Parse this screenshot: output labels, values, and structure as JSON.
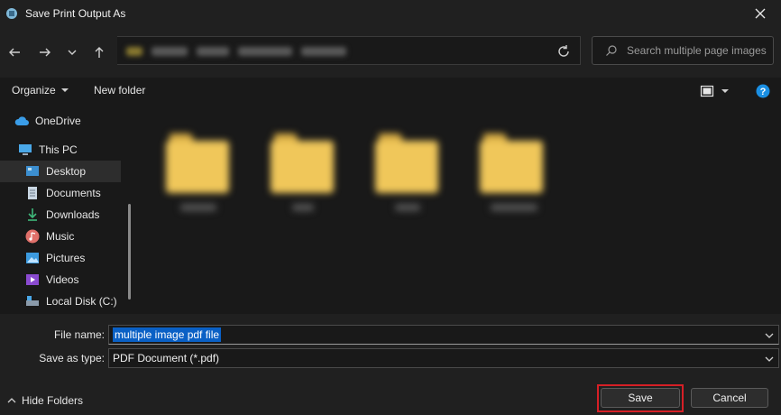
{
  "window": {
    "title": "Save Print Output As"
  },
  "navigation": {
    "back": "back-arrow",
    "forward": "forward-arrow",
    "recent": "chevron-down",
    "up": "up-arrow",
    "search_placeholder": "Search multiple page images"
  },
  "toolbar": {
    "organize_label": "Organize",
    "new_folder_label": "New folder"
  },
  "sidebar": {
    "items": [
      {
        "label": "OneDrive",
        "icon": "cloud-icon"
      },
      {
        "label": "This PC",
        "icon": "computer-icon"
      },
      {
        "label": "Desktop",
        "icon": "desktop-icon",
        "selected": true
      },
      {
        "label": "Documents",
        "icon": "documents-icon"
      },
      {
        "label": "Downloads",
        "icon": "download-icon"
      },
      {
        "label": "Music",
        "icon": "music-icon"
      },
      {
        "label": "Pictures",
        "icon": "pictures-icon"
      },
      {
        "label": "Videos",
        "icon": "videos-icon"
      },
      {
        "label": "Local Disk (C:)",
        "icon": "disk-icon"
      }
    ]
  },
  "form": {
    "file_name_label": "File name:",
    "file_name_value": "multiple image pdf file",
    "save_type_label": "Save as type:",
    "save_type_value": "PDF Document (*.pdf)"
  },
  "footer": {
    "hide_folders_label": "Hide Folders",
    "save_label": "Save",
    "cancel_label": "Cancel"
  },
  "colors": {
    "accent": "#0a60c5",
    "folder": "#f0c75a",
    "highlight_outline": "#d61f26",
    "help_icon": "#1a8fe3"
  }
}
